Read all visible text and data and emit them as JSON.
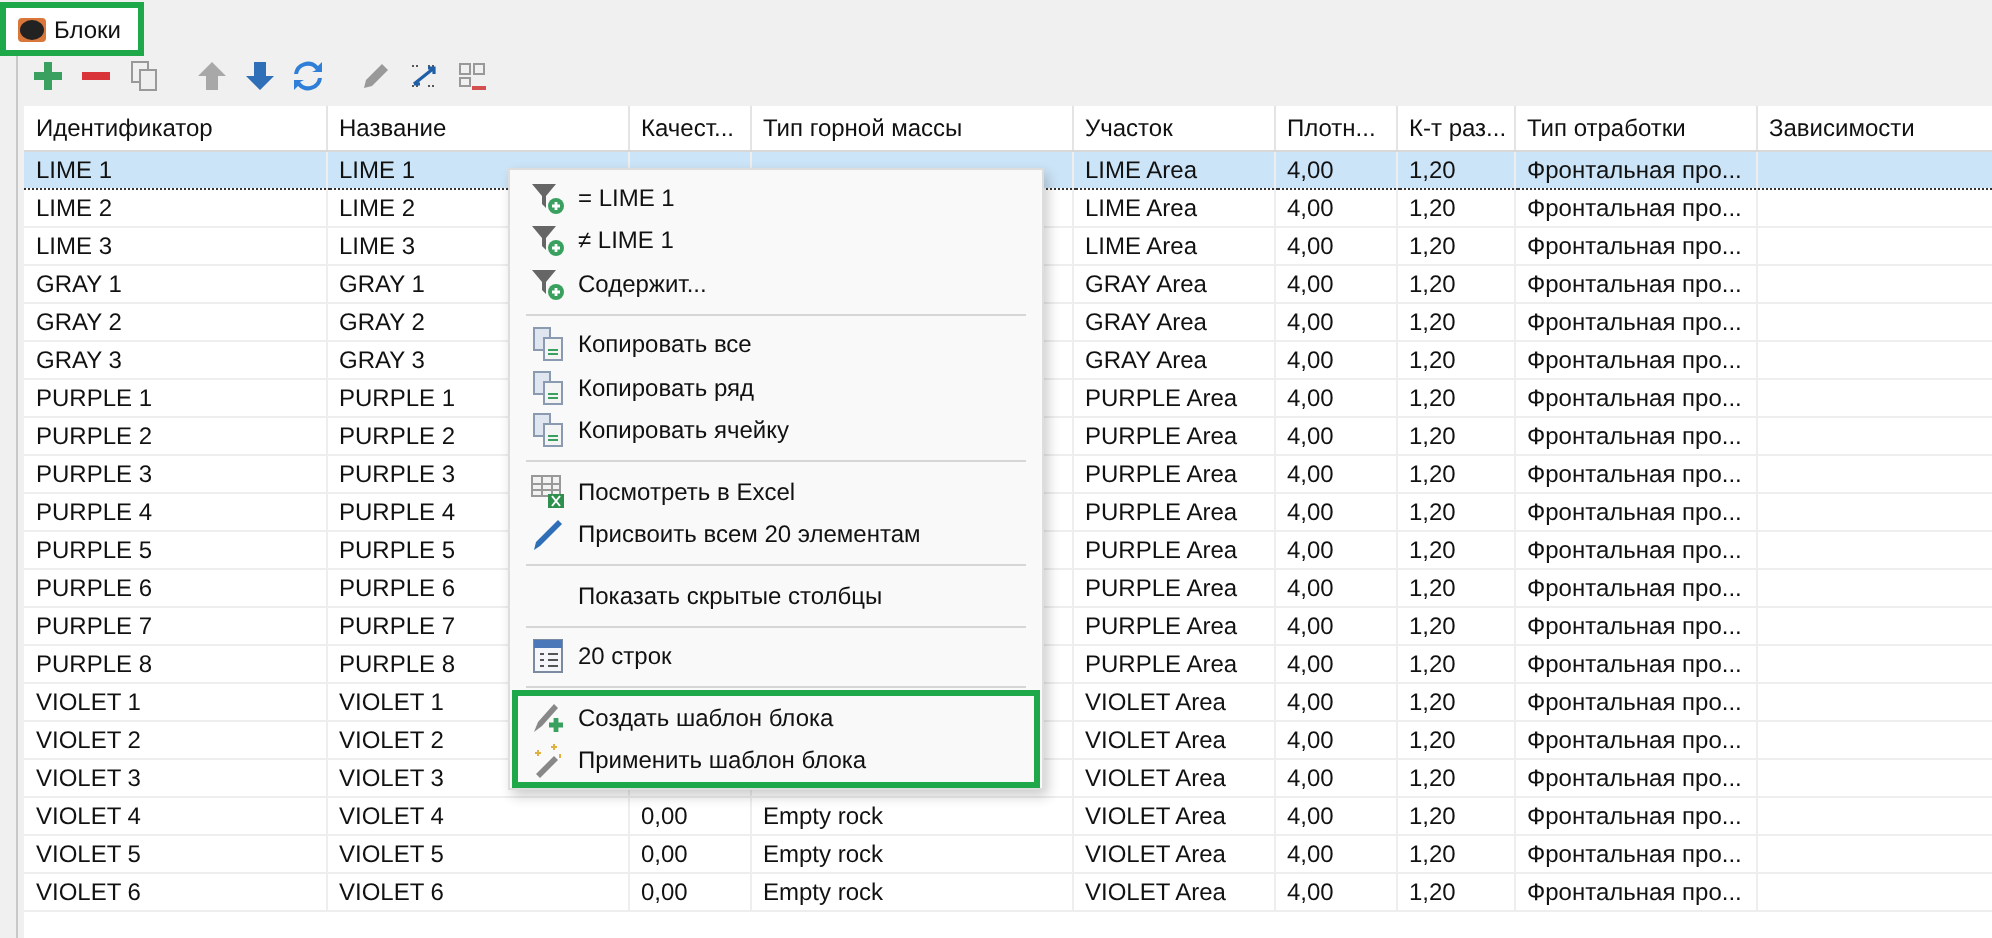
{
  "tab": {
    "label": "Блоки",
    "selected": true,
    "highlighted": true
  },
  "toolbar": [
    {
      "kind": "add",
      "disabled": false
    },
    {
      "kind": "remove",
      "disabled": false
    },
    {
      "kind": "copy",
      "disabled": true
    },
    {
      "kind": "up",
      "disabled": true
    },
    {
      "kind": "down",
      "disabled": false
    },
    {
      "kind": "refresh",
      "disabled": false
    },
    {
      "kind": "pencil",
      "disabled": true
    },
    {
      "kind": "swap",
      "disabled": false
    },
    {
      "kind": "grid",
      "disabled": true
    }
  ],
  "table": {
    "columns": [
      "Идентификатор",
      "Название",
      "Качест...",
      "Тип горной массы",
      "Участок",
      "Плотн...",
      "К-т раз...",
      "Тип отработки",
      "Зависимости"
    ],
    "rows": [
      {
        "selected": true,
        "cells": [
          "LIME 1",
          "LIME 1",
          null,
          null,
          "LIME Area",
          "4,00",
          "1,20",
          "Фронтальная про..."
        ]
      },
      {
        "selected": false,
        "cells": [
          "LIME 2",
          "LIME 2",
          null,
          null,
          "LIME Area",
          "4,00",
          "1,20",
          "Фронтальная про..."
        ]
      },
      {
        "selected": false,
        "cells": [
          "LIME 3",
          "LIME 3",
          null,
          null,
          "LIME Area",
          "4,00",
          "1,20",
          "Фронтальная про..."
        ]
      },
      {
        "selected": false,
        "cells": [
          "GRAY 1",
          "GRAY 1",
          null,
          null,
          "GRAY Area",
          "4,00",
          "1,20",
          "Фронтальная про..."
        ]
      },
      {
        "selected": false,
        "cells": [
          "GRAY 2",
          "GRAY 2",
          null,
          null,
          "GRAY Area",
          "4,00",
          "1,20",
          "Фронтальная про..."
        ]
      },
      {
        "selected": false,
        "cells": [
          "GRAY 3",
          "GRAY 3",
          null,
          null,
          "GRAY Area",
          "4,00",
          "1,20",
          "Фронтальная про..."
        ]
      },
      {
        "selected": false,
        "cells": [
          "PURPLE 1",
          "PURPLE 1",
          null,
          null,
          "PURPLE Area",
          "4,00",
          "1,20",
          "Фронтальная про..."
        ]
      },
      {
        "selected": false,
        "cells": [
          "PURPLE 2",
          "PURPLE 2",
          null,
          null,
          "PURPLE Area",
          "4,00",
          "1,20",
          "Фронтальная про..."
        ]
      },
      {
        "selected": false,
        "cells": [
          "PURPLE 3",
          "PURPLE 3",
          null,
          null,
          "PURPLE Area",
          "4,00",
          "1,20",
          "Фронтальная про..."
        ]
      },
      {
        "selected": false,
        "cells": [
          "PURPLE 4",
          "PURPLE 4",
          null,
          null,
          "PURPLE Area",
          "4,00",
          "1,20",
          "Фронтальная про..."
        ]
      },
      {
        "selected": false,
        "cells": [
          "PURPLE 5",
          "PURPLE 5",
          null,
          null,
          "PURPLE Area",
          "4,00",
          "1,20",
          "Фронтальная про..."
        ]
      },
      {
        "selected": false,
        "cells": [
          "PURPLE 6",
          "PURPLE 6",
          null,
          null,
          "PURPLE Area",
          "4,00",
          "1,20",
          "Фронтальная про..."
        ]
      },
      {
        "selected": false,
        "cells": [
          "PURPLE 7",
          "PURPLE 7",
          null,
          null,
          "PURPLE Area",
          "4,00",
          "1,20",
          "Фронтальная про..."
        ]
      },
      {
        "selected": false,
        "cells": [
          "PURPLE 8",
          "PURPLE 8",
          null,
          null,
          "PURPLE Area",
          "4,00",
          "1,20",
          "Фронтальная про..."
        ]
      },
      {
        "selected": false,
        "cells": [
          "VIOLET 1",
          "VIOLET 1",
          null,
          null,
          "VIOLET Area",
          "4,00",
          "1,20",
          "Фронтальная про..."
        ]
      },
      {
        "selected": false,
        "cells": [
          "VIOLET 2",
          "VIOLET 2",
          null,
          null,
          "VIOLET Area",
          "4,00",
          "1,20",
          "Фронтальная про..."
        ]
      },
      {
        "selected": false,
        "cells": [
          "VIOLET 3",
          "VIOLET 3",
          null,
          null,
          "VIOLET Area",
          "4,00",
          "1,20",
          "Фронтальная про..."
        ]
      },
      {
        "selected": false,
        "cells": [
          "VIOLET 4",
          "VIOLET 4",
          "0,00",
          "Empty rock",
          "VIOLET Area",
          "4,00",
          "1,20",
          "Фронтальная про..."
        ]
      },
      {
        "selected": false,
        "cells": [
          "VIOLET 5",
          "VIOLET 5",
          "0,00",
          "Empty rock",
          "VIOLET Area",
          "4,00",
          "1,20",
          "Фронтальная про..."
        ]
      },
      {
        "selected": false,
        "cells": [
          "VIOLET 6",
          "VIOLET 6",
          "0,00",
          "Empty rock",
          "VIOLET Area",
          "4,00",
          "1,20",
          "Фронтальная про..."
        ]
      }
    ]
  },
  "context_menu": {
    "groups": [
      {
        "highlighted": false,
        "items": [
          {
            "kind": "filter",
            "label": "= LIME 1"
          },
          {
            "kind": "filter",
            "label": "≠ LIME 1"
          },
          {
            "kind": "filter",
            "label": "Содержит..."
          }
        ]
      },
      {
        "highlighted": false,
        "items": [
          {
            "kind": "copy",
            "label": "Копировать все"
          },
          {
            "kind": "copy",
            "label": "Копировать ряд"
          },
          {
            "kind": "copy",
            "label": "Копировать ячейку"
          }
        ]
      },
      {
        "highlighted": false,
        "items": [
          {
            "kind": "excel",
            "label": "Посмотреть в Excel"
          },
          {
            "kind": "pencil",
            "label": "Присвоить всем 20 элементам"
          }
        ]
      },
      {
        "highlighted": false,
        "items": [
          {
            "kind": "plain",
            "label": "Показать скрытые столбцы"
          }
        ]
      },
      {
        "highlighted": false,
        "items": [
          {
            "kind": "list",
            "label": "20 строк"
          }
        ]
      },
      {
        "highlighted": true,
        "items": [
          {
            "kind": "template-create",
            "label": "Создать шаблон блока"
          },
          {
            "kind": "template-apply",
            "label": "Применить шаблон блока"
          }
        ]
      }
    ]
  }
}
